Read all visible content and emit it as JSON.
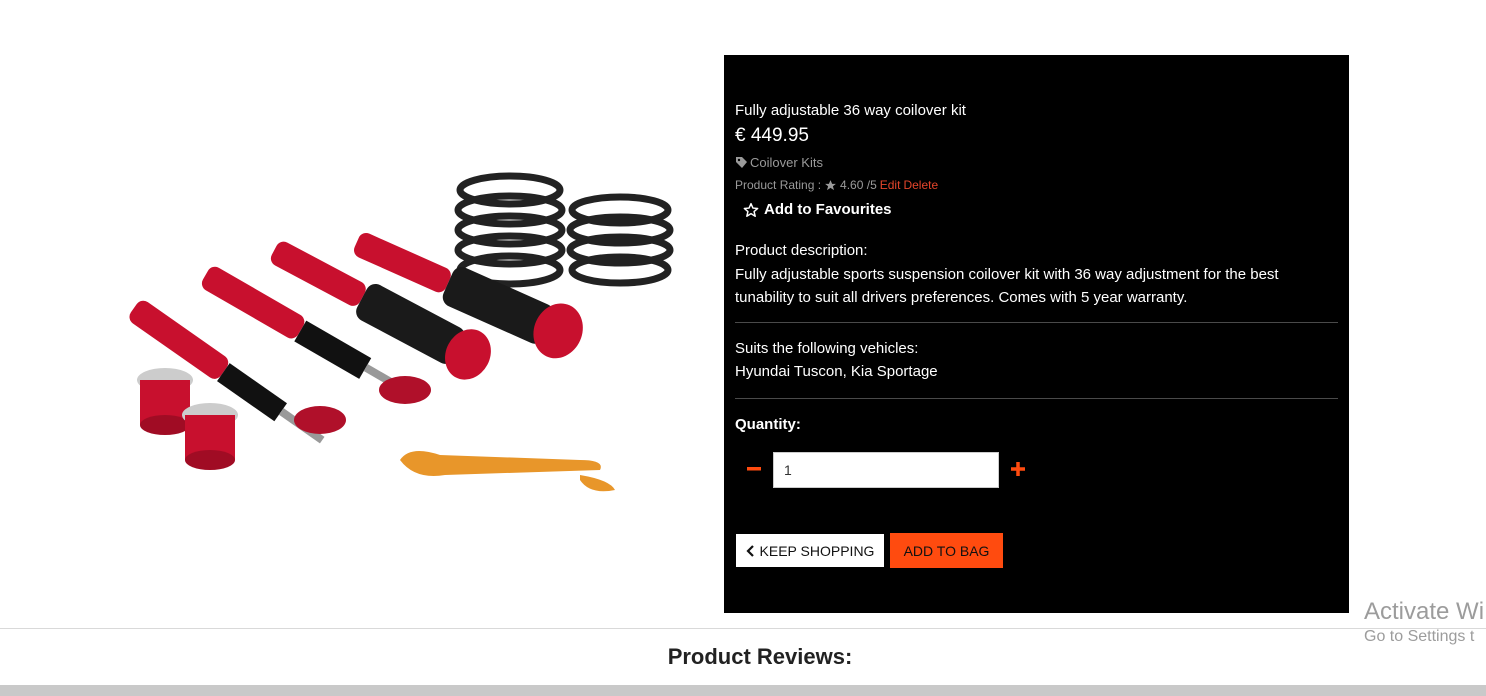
{
  "product": {
    "name": "Fully adjustable 36 way coilover kit",
    "price": "€ 449.95",
    "category": "Coilover Kits",
    "rating_label": "Product Rating :",
    "rating_value": "4.60 /5",
    "edit_label": "Edit",
    "delete_label": "Delete",
    "favourite_label": "Add to Favourites",
    "description_heading": "Product description:",
    "description": "Fully adjustable sports suspension coilover kit with 36 way adjustment for the best tunability to suit all drivers preferences. Comes with 5 year warranty.",
    "vehicles_heading": "Suits the following vehicles:",
    "vehicles": "Hyundai Tuscon, Kia Sportage"
  },
  "quantity": {
    "label": "Quantity:",
    "value": "1"
  },
  "buttons": {
    "keep_shopping": "KEEP SHOPPING",
    "add_to_bag": "ADD TO BAG"
  },
  "reviews": {
    "title": "Product Reviews:"
  },
  "watermark": {
    "line1": "Activate Wi",
    "line2": "Go to Settings t"
  },
  "colors": {
    "accent": "#ff4b0f",
    "link_red": "#e5452b",
    "panel_bg": "#000000"
  }
}
